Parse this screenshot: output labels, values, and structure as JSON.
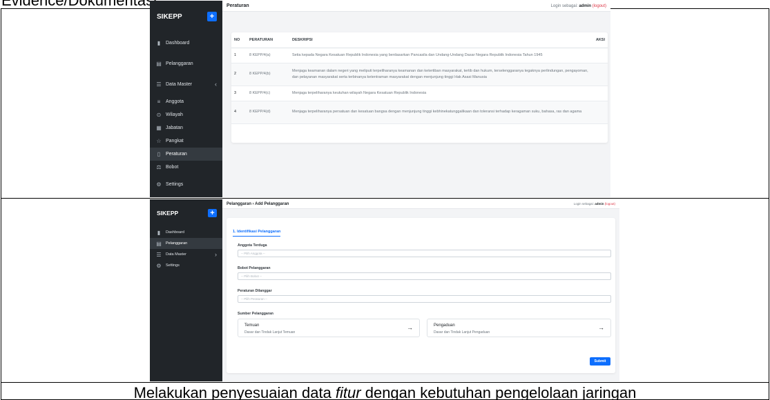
{
  "heading": "Evidence/Dokumentasi :",
  "shot1": {
    "brand": "SIKEPP",
    "plus": "+",
    "menu": [
      {
        "label": "Dashboard",
        "icon": "chart-icon"
      },
      {
        "label": "Pelanggaran",
        "icon": "document-icon"
      },
      {
        "label": "Data Master",
        "icon": "list-icon",
        "chevron": "‹"
      },
      {
        "label": "Anggota",
        "icon": "users-icon"
      },
      {
        "label": "Wilayah",
        "icon": "location-icon"
      },
      {
        "label": "Jabatan",
        "icon": "grid-icon"
      },
      {
        "label": "Pangkat",
        "icon": "star-icon"
      },
      {
        "label": "Peraturan",
        "icon": "clipboard-icon",
        "active": true
      },
      {
        "label": "Bobot",
        "icon": "scale-icon"
      },
      {
        "label": "Settings",
        "icon": "gear-icon"
      }
    ],
    "page_title": "Peraturan",
    "login_prefix": "Login sebagai:",
    "login_user": "admin",
    "logout": "(logout)",
    "columns": [
      "NO",
      "PERATURAN",
      "DESKRIPSI",
      "AKSI"
    ],
    "rows": [
      {
        "no": "1",
        "code": "8 KEPP/4(a)",
        "desc": "Setia kepada Negara Kesatuan Republik Indonesia yang berdasarkan Pancasila dan Undang-Undang Dasar Negara Republik Indonesia Tahun 1945"
      },
      {
        "no": "2",
        "code": "8 KEPP/4(b)",
        "desc": "Menjaga keamanan dalam negeri yang meliputi terpeliharanya keamanan dan ketertiban masyarakat, tertib dan hukum, terselenggaranya tegaknya perlindungan, pengayoman, dan pelayanan masyarakat serta terbinanya ketentraman masyarakat dengan menjunjung tinggi Hak Asasi Manusia"
      },
      {
        "no": "3",
        "code": "8 KEPP/4(c)",
        "desc": "Menjaga terpeliharanya keutuhan wilayah Negara Kesatuan Republik Indonesia"
      },
      {
        "no": "4",
        "code": "8 KEPP/4(d)",
        "desc": "Menjaga terpeliharanya persatuan dan kesatuan bangsa dengan menjunjung tinggi kebhinekatunggalikaan dan toleransi terhadap keragaman suku, bahasa, ras dan agama"
      }
    ]
  },
  "shot2": {
    "brand": "SIKEPP",
    "plus": "+",
    "menu": [
      {
        "label": "Dashboard",
        "icon": "chart-icon"
      },
      {
        "label": "Pelanggaran",
        "icon": "document-icon",
        "active": true
      },
      {
        "label": "Data Master",
        "icon": "list-icon",
        "chevron": "›"
      },
      {
        "label": "Settings",
        "icon": "gear-icon"
      }
    ],
    "breadcrumb": "Pelanggaran › Add Pelanggaran",
    "login_prefix": "Login sebagai:",
    "login_user": "admin",
    "logout": "(logout)",
    "tab": "1. Identifikasi Pelanggaran",
    "fields": [
      {
        "label": "Anggota Terduga",
        "placeholder": "-- Pilih Anggota --"
      },
      {
        "label": "Bobot Pelanggaran",
        "placeholder": "-- Pilih Bobot --"
      },
      {
        "label": "Peraturan Dilanggar",
        "placeholder": "-- Pilih Peraturan --"
      }
    ],
    "source_label": "Sumber Pelanggaran",
    "options": [
      {
        "title": "Temuan",
        "desc": "Dasar dan Tindak Lanjut Temuan",
        "arrow": "→"
      },
      {
        "title": "Pengaduan",
        "desc": "Dasar dan Tindak Lanjut Pengaduan",
        "arrow": "→"
      }
    ],
    "submit": "Submit"
  },
  "caption_pre": "Melakukan penyesuaian data ",
  "caption_em": "fitur",
  "caption_post": " dengan kebutuhan pengelolaan jaringan"
}
